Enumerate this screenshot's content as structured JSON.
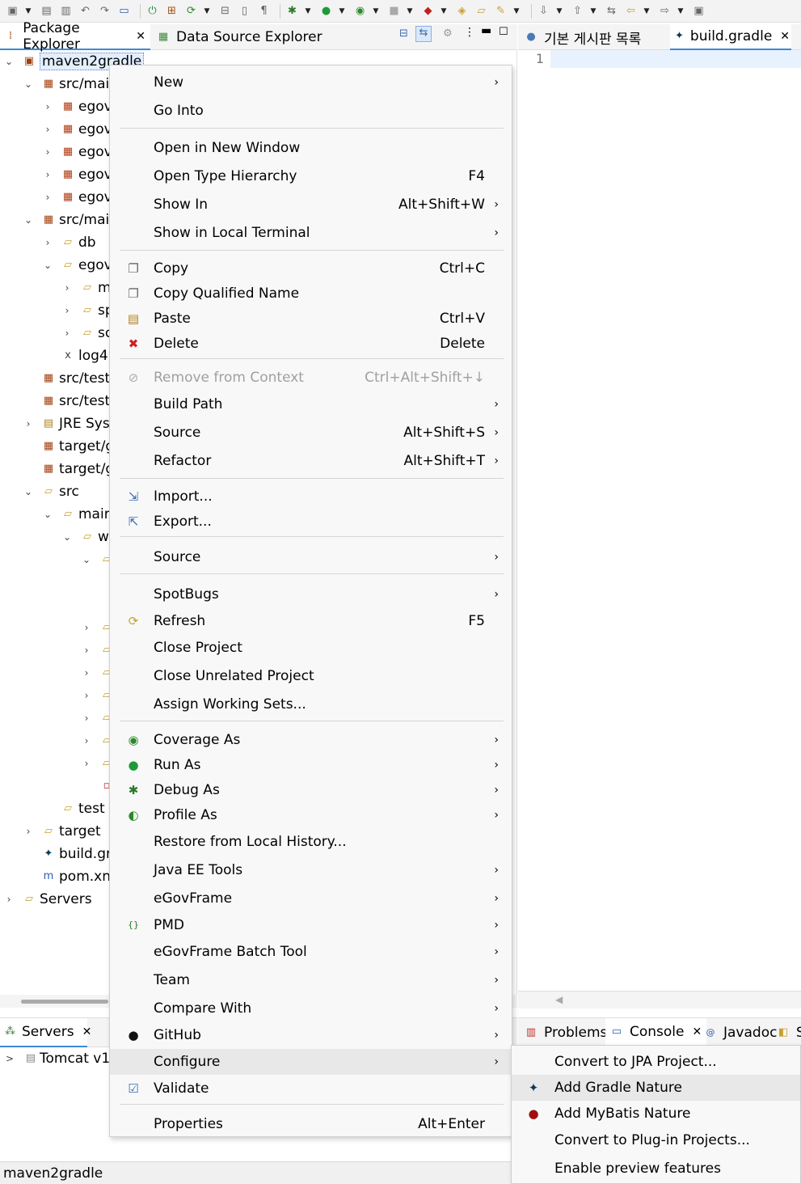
{
  "left_tabs": {
    "package_explorer": "Package Explorer",
    "data_source_explorer": "Data Source Explorer"
  },
  "editor_tabs": {
    "board": "기본 게시판 목록",
    "gradle": "build.gradle"
  },
  "editor": {
    "line1": "1"
  },
  "tree": [
    {
      "label": "maven2gradle",
      "depth": 0,
      "icon": "project-icon",
      "tw": "v",
      "selected": true
    },
    {
      "label": "src/mai",
      "depth": 1,
      "icon": "package-folder-icon",
      "tw": "v"
    },
    {
      "label": "egov",
      "depth": 2,
      "icon": "package-icon",
      "tw": ">"
    },
    {
      "label": "egov",
      "depth": 2,
      "icon": "package-icon",
      "tw": ">"
    },
    {
      "label": "egov",
      "depth": 2,
      "icon": "package-icon",
      "tw": ">"
    },
    {
      "label": "egov",
      "depth": 2,
      "icon": "package-icon",
      "tw": ">"
    },
    {
      "label": "egov",
      "depth": 2,
      "icon": "package-icon",
      "tw": ">"
    },
    {
      "label": "src/mai",
      "depth": 1,
      "icon": "package-folder-icon",
      "tw": "v"
    },
    {
      "label": "db",
      "depth": 2,
      "icon": "folder-icon",
      "tw": ">"
    },
    {
      "label": "egov",
      "depth": 2,
      "icon": "folder-icon",
      "tw": "v"
    },
    {
      "label": "m",
      "depth": 3,
      "icon": "folder-icon",
      "tw": ">"
    },
    {
      "label": "sp",
      "depth": 3,
      "icon": "folder-icon",
      "tw": ">"
    },
    {
      "label": "sc",
      "depth": 3,
      "icon": "folder-icon",
      "tw": ">"
    },
    {
      "label": "log4",
      "depth": 2,
      "icon": "xml-file-icon",
      "tw": ""
    },
    {
      "label": "src/test",
      "depth": 1,
      "icon": "package-folder-icon",
      "tw": ""
    },
    {
      "label": "src/test",
      "depth": 1,
      "icon": "package-folder-icon",
      "tw": ""
    },
    {
      "label": "JRE Sys",
      "depth": 1,
      "icon": "library-icon",
      "tw": ">"
    },
    {
      "label": "target/g",
      "depth": 1,
      "icon": "package-folder-icon",
      "tw": ""
    },
    {
      "label": "target/g",
      "depth": 1,
      "icon": "package-folder-icon",
      "tw": ""
    },
    {
      "label": "src",
      "depth": 1,
      "icon": "folder-icon",
      "tw": "v"
    },
    {
      "label": "mair",
      "depth": 2,
      "icon": "folder-icon",
      "tw": "v"
    },
    {
      "label": "w",
      "depth": 3,
      "icon": "folder-icon",
      "tw": "v"
    },
    {
      "label": "",
      "depth": 4,
      "icon": "folder-icon",
      "tw": "v"
    },
    {
      "label": "",
      "depth": 5,
      "icon": "folder-icon",
      "tw": ""
    },
    {
      "label": "",
      "depth": 4,
      "icon": "folder-icon",
      "tw": ">"
    },
    {
      "label": "",
      "depth": 4,
      "icon": "folder-icon",
      "tw": ">"
    },
    {
      "label": "",
      "depth": 4,
      "icon": "folder-icon",
      "tw": ">"
    },
    {
      "label": "",
      "depth": 4,
      "icon": "folder-icon",
      "tw": ">"
    },
    {
      "label": "",
      "depth": 4,
      "icon": "folder-icon",
      "tw": ">"
    },
    {
      "label": "",
      "depth": 4,
      "icon": "folder-icon",
      "tw": ">"
    },
    {
      "label": "",
      "depth": 4,
      "icon": "folder-icon",
      "tw": ">"
    },
    {
      "label": "",
      "depth": 4,
      "icon": "file-icon",
      "tw": ""
    },
    {
      "label": "test",
      "depth": 2,
      "icon": "folder-icon",
      "tw": ""
    },
    {
      "label": "target",
      "depth": 1,
      "icon": "folder-icon",
      "tw": ">"
    },
    {
      "label": "build.gr",
      "depth": 1,
      "icon": "gradle-icon",
      "tw": ""
    },
    {
      "label": "pom.xn",
      "depth": 1,
      "icon": "maven-icon",
      "tw": ""
    },
    {
      "label": "Servers",
      "depth": 0,
      "icon": "folder-icon",
      "tw": ">"
    }
  ],
  "servers_view": {
    "tab": "Servers",
    "item": "Tomcat v1"
  },
  "console_tabs": {
    "problems": "Problems",
    "console": "Console",
    "javadoc": "Javadoc",
    "more": "S"
  },
  "status_bar": "maven2gradle",
  "context_menu": [
    {
      "label": "New",
      "accel": "",
      "sub": true,
      "icon": ""
    },
    {
      "label": "Go Into",
      "accel": "",
      "sub": false,
      "icon": ""
    },
    {
      "sep": true
    },
    {
      "label": "Open in New Window",
      "accel": "",
      "sub": false,
      "icon": ""
    },
    {
      "label": "Open Type Hierarchy",
      "accel": "F4",
      "sub": false,
      "icon": ""
    },
    {
      "label": "Show In",
      "accel": "Alt+Shift+W",
      "sub": true,
      "icon": ""
    },
    {
      "label": "Show in Local Terminal",
      "accel": "",
      "sub": true,
      "icon": ""
    },
    {
      "sep": true
    },
    {
      "label": "Copy",
      "accel": "Ctrl+C",
      "sub": false,
      "icon": "copy-icon"
    },
    {
      "label": "Copy Qualified Name",
      "accel": "",
      "sub": false,
      "icon": "copy-qualified-icon"
    },
    {
      "label": "Paste",
      "accel": "Ctrl+V",
      "sub": false,
      "icon": "paste-icon"
    },
    {
      "label": "Delete",
      "accel": "Delete",
      "sub": false,
      "icon": "delete-icon"
    },
    {
      "sep": true
    },
    {
      "label": "Remove from Context",
      "accel": "Ctrl+Alt+Shift+↓",
      "sub": false,
      "icon": "remove-context-icon",
      "disabled": true
    },
    {
      "label": "Build Path",
      "accel": "",
      "sub": true,
      "icon": ""
    },
    {
      "label": "Source",
      "accel": "Alt+Shift+S",
      "sub": true,
      "icon": ""
    },
    {
      "label": "Refactor",
      "accel": "Alt+Shift+T",
      "sub": true,
      "icon": ""
    },
    {
      "sep": true
    },
    {
      "label": "Import...",
      "accel": "",
      "sub": false,
      "icon": "import-icon"
    },
    {
      "label": "Export...",
      "accel": "",
      "sub": false,
      "icon": "export-icon"
    },
    {
      "sep": true
    },
    {
      "label": "Source",
      "accel": "",
      "sub": true,
      "icon": ""
    },
    {
      "sep": true
    },
    {
      "label": "SpotBugs",
      "accel": "",
      "sub": true,
      "icon": ""
    },
    {
      "label": "Refresh",
      "accel": "F5",
      "sub": false,
      "icon": "refresh-icon"
    },
    {
      "label": "Close Project",
      "accel": "",
      "sub": false,
      "icon": ""
    },
    {
      "label": "Close Unrelated Project",
      "accel": "",
      "sub": false,
      "icon": ""
    },
    {
      "label": "Assign Working Sets...",
      "accel": "",
      "sub": false,
      "icon": ""
    },
    {
      "sep": true
    },
    {
      "label": "Coverage As",
      "accel": "",
      "sub": true,
      "icon": "coverage-icon"
    },
    {
      "label": "Run As",
      "accel": "",
      "sub": true,
      "icon": "run-icon"
    },
    {
      "label": "Debug As",
      "accel": "",
      "sub": true,
      "icon": "debug-icon"
    },
    {
      "label": "Profile As",
      "accel": "",
      "sub": true,
      "icon": "profile-icon"
    },
    {
      "label": "Restore from Local History...",
      "accel": "",
      "sub": false,
      "icon": ""
    },
    {
      "label": "Java EE Tools",
      "accel": "",
      "sub": true,
      "icon": ""
    },
    {
      "label": "eGovFrame",
      "accel": "",
      "sub": true,
      "icon": ""
    },
    {
      "label": "PMD",
      "accel": "",
      "sub": true,
      "icon": "pmd-icon"
    },
    {
      "label": "eGovFrame Batch Tool",
      "accel": "",
      "sub": true,
      "icon": ""
    },
    {
      "label": "Team",
      "accel": "",
      "sub": true,
      "icon": ""
    },
    {
      "label": "Compare With",
      "accel": "",
      "sub": true,
      "icon": ""
    },
    {
      "label": "GitHub",
      "accel": "",
      "sub": true,
      "icon": "github-icon"
    },
    {
      "label": "Configure",
      "accel": "",
      "sub": true,
      "icon": "",
      "highlight": true
    },
    {
      "label": "Validate",
      "accel": "",
      "sub": false,
      "icon": "validate-icon"
    },
    {
      "sep": true
    },
    {
      "label": "Properties",
      "accel": "Alt+Enter",
      "sub": false,
      "icon": ""
    }
  ],
  "submenu": [
    {
      "label": "Convert to JPA Project...",
      "icon": ""
    },
    {
      "label": "Add Gradle Nature",
      "icon": "gradle-icon",
      "highlight": true
    },
    {
      "label": "Add MyBatis Nature",
      "icon": "mybatis-icon"
    },
    {
      "label": "Convert to Plug-in Projects...",
      "icon": ""
    },
    {
      "label": "Enable preview features",
      "icon": ""
    }
  ]
}
